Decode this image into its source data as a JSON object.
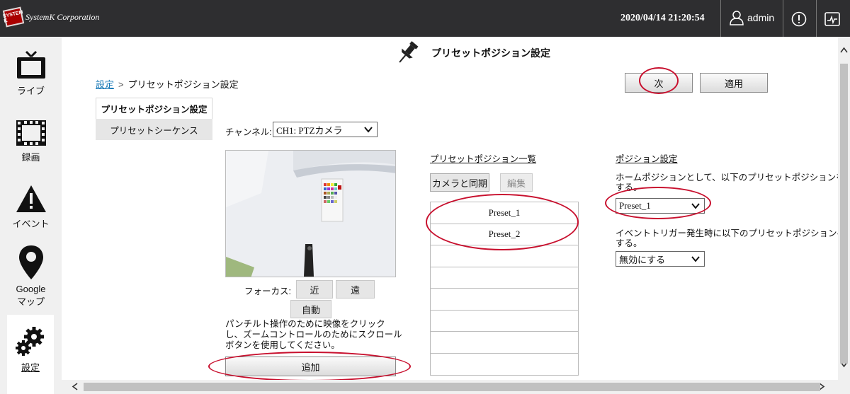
{
  "header": {
    "logo_badge": "SYSTEM K",
    "logo_text": "SystemK Corporation",
    "datetime": "2020/04/14 21:20:54",
    "user": "admin",
    "icons": [
      "user-icon",
      "alert-icon",
      "monitor-icon"
    ]
  },
  "sidebar": {
    "items": [
      {
        "label": "ライブ",
        "icon": "tv-icon"
      },
      {
        "label": "録画",
        "icon": "film-icon"
      },
      {
        "label": "イベント",
        "icon": "warning-icon"
      },
      {
        "label": "Google",
        "label2": "マップ",
        "icon": "map-pin-icon"
      },
      {
        "label": "設定",
        "icon": "gears-icon"
      }
    ]
  },
  "page": {
    "title": "プリセットポジション設定",
    "breadcrumb_link": "設定",
    "breadcrumb_sep": ">",
    "breadcrumb_current": "プリセットポジション設定",
    "next_button": "次",
    "apply_button": "適用"
  },
  "tabs": [
    {
      "label": "プリセットポジション設定",
      "active": true
    },
    {
      "label": "プリセットシーケンス",
      "active": false
    }
  ],
  "channel": {
    "label": "チャンネル:",
    "selected": "CH1: PTZカメラ"
  },
  "focus": {
    "label": "フォーカス:",
    "near": "近",
    "far": "遠",
    "auto": "自動"
  },
  "help_text": "パンチルト操作のために映像をクリックし、ズームコントロールのためにスクロールボタンを使用してください。",
  "add_button": "追加",
  "preset_list": {
    "title": "プリセットポジション一覧",
    "sync_button": "カメラと同期",
    "edit_button": "編集",
    "rows": [
      "Preset_1",
      "Preset_2",
      "",
      "",
      "",
      "",
      "",
      ""
    ]
  },
  "position_settings": {
    "title": "ポジション設定",
    "home_text_line1": "ホームポジションとして、以下のプリセットポジションを設定",
    "home_text_line2": "する。",
    "home_selected": "Preset_1",
    "event_text_line1": "イベントトリガー発生時に以下のプリセットポジションへ移",
    "event_text_line2": "する。",
    "event_selected": "無効にする"
  },
  "colors": {
    "topbar": "#2e2e30",
    "link": "#1a7ab7",
    "annotation_red": "#c8102e"
  }
}
